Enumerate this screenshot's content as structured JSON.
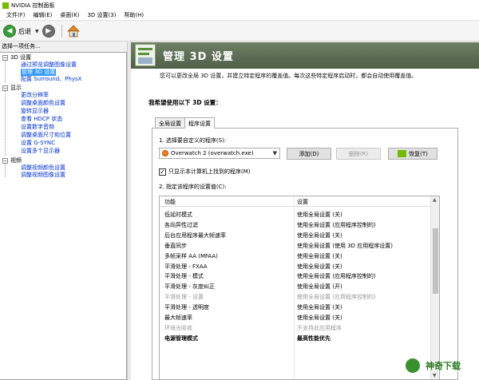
{
  "window": {
    "title": "NVIDIA 控制面板"
  },
  "menu": [
    "文件(F)",
    "编辑(E)",
    "桌面(K)",
    "3D 设置(3)",
    "帮助(H)"
  ],
  "toolbar": {
    "back_label": "后退"
  },
  "tasks": {
    "header": "选择一项任务...",
    "categories": [
      {
        "label": "3D 设置",
        "items": [
          "通过预览调整图像设置",
          "管理 3D 设置",
          "配置 Surround、PhysX"
        ]
      },
      {
        "label": "显示",
        "items": [
          "更改分辨率",
          "调整桌面颜色设置",
          "旋转显示器",
          "查看 HDCP 状态",
          "设置数字音频",
          "调整桌面尺寸和位置",
          "设置 G-SYNC",
          "设置多个显示器"
        ]
      },
      {
        "label": "视频",
        "items": [
          "调整视频颜色设置",
          "调整视频图像设置"
        ]
      }
    ],
    "selected": "管理 3D 设置"
  },
  "main": {
    "title": "管理 3D 设置",
    "description": "您可以更改全局 3D 设置，并建立特定程序的覆盖值。每次这些特定程序启动时，都会自动使用覆盖值。",
    "section_title": "我希望使用以下 3D 设置：",
    "tabs": [
      "全局设置",
      "程序设置"
    ],
    "active_tab": "程序设置",
    "select_program_label": "1. 选择要自定义的程序(S):",
    "program_selected": "Overwatch 2 (overwatch.exe)",
    "buttons": {
      "add": "添加(D)",
      "remove": "删除(R)",
      "restore": "恢复(T)"
    },
    "only_show_found": "只显示本计算机上找到的程序(M)",
    "only_show_found_checked": "✓",
    "specify_label": "2. 指定该程序的设置值(C):",
    "columns": {
      "feature": "功能",
      "setting": "设置"
    },
    "rows": [
      {
        "feature": "低延时模式",
        "setting": "使用全局设置 (关)",
        "state": "normal"
      },
      {
        "feature": "各向异性过滤",
        "setting": "使用全局设置 (应用程序控制的)",
        "state": "normal"
      },
      {
        "feature": "后台应用程序最大帧速率",
        "setting": "使用全局设置 (关)",
        "state": "normal"
      },
      {
        "feature": "垂直同步",
        "setting": "使用全局设置 (使用 3D 应用程序设置)",
        "state": "normal"
      },
      {
        "feature": "多帧采样 AA (MFAA)",
        "setting": "使用全局设置 (关)",
        "state": "normal"
      },
      {
        "feature": "平滑处理 - FXAA",
        "setting": "使用全局设置 (关)",
        "state": "normal"
      },
      {
        "feature": "平滑处理 - 模式",
        "setting": "使用全局设置 (应用程序控制的)",
        "state": "normal"
      },
      {
        "feature": "平滑处理 - 灰度纠正",
        "setting": "使用全局设置 (开)",
        "state": "normal"
      },
      {
        "feature": "平滑处理 - 设置",
        "setting": "使用全局设置 (应用程序控制的)",
        "state": "disabled"
      },
      {
        "feature": "平滑处理 - 透明度",
        "setting": "使用全局设置 (关)",
        "state": "normal"
      },
      {
        "feature": "最大帧速率",
        "setting": "使用全局设置 (关)",
        "state": "normal"
      },
      {
        "feature": "环境光吸收",
        "setting": "不支持此应用程序",
        "state": "disabled"
      },
      {
        "feature": "电源管理模式",
        "setting": "最高性能优先",
        "state": "bold"
      }
    ]
  },
  "watermark": {
    "text": "神奇下载"
  },
  "colors": {
    "nvidia_green": "#76b900",
    "banner": "#5f6f57",
    "selection": "#3399ff",
    "link": "#0033cc"
  }
}
